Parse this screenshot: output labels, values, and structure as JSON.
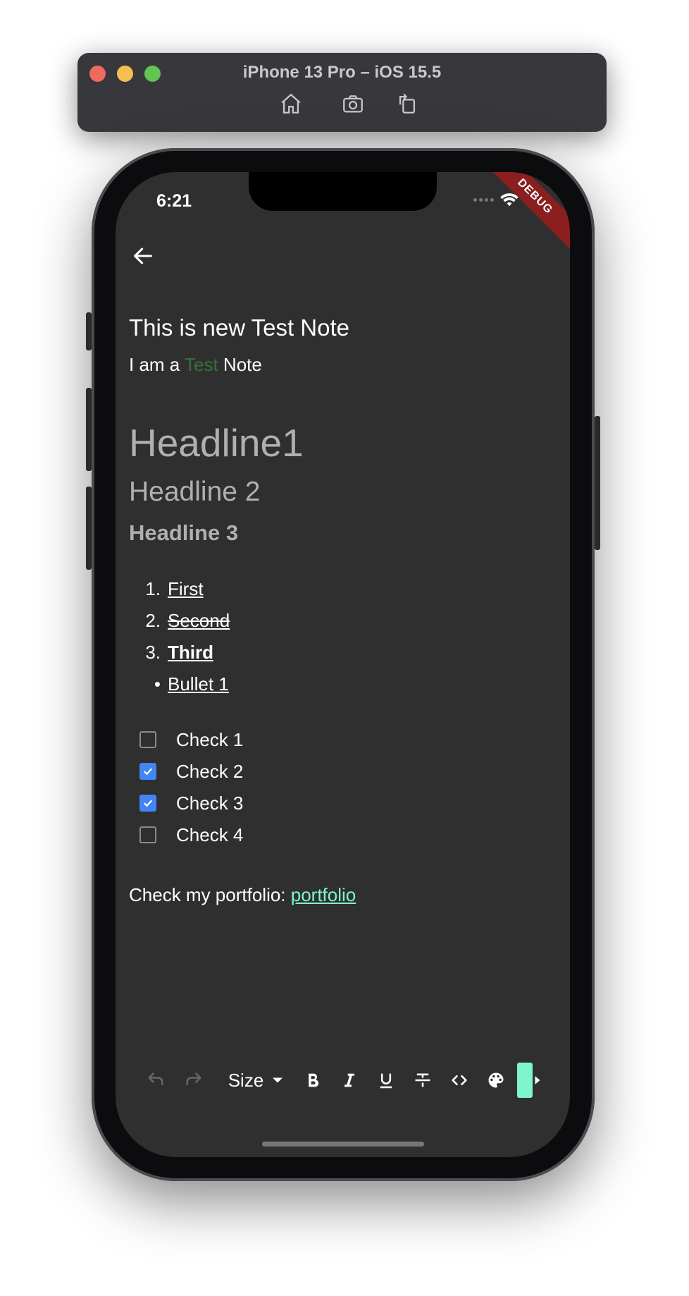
{
  "simulator": {
    "title": "iPhone 13 Pro – iOS 15.5",
    "buttons": [
      "home-icon",
      "screenshot-icon",
      "rotate-icon"
    ]
  },
  "status_bar": {
    "time": "6:21",
    "debug_label": "DEBUG"
  },
  "note": {
    "title": "This is new Test Note",
    "subtitle_prefix": "I am a ",
    "subtitle_highlight": "Test",
    "subtitle_suffix": " Note",
    "highlight_color": "#36703b",
    "headline1": "Headline1",
    "headline2": "Headline 2",
    "headline3": "Headline 3",
    "list": [
      {
        "marker": "1.",
        "text": "First",
        "style": "underline"
      },
      {
        "marker": "2.",
        "text": "Second",
        "style": "strikethrough"
      },
      {
        "marker": "3.",
        "text": "Third",
        "style": "bold"
      },
      {
        "marker": "•",
        "text": "Bullet 1",
        "style": "underline"
      }
    ],
    "checklist": [
      {
        "text": "Check 1",
        "checked": false
      },
      {
        "text": "Check 2",
        "checked": true
      },
      {
        "text": "Check 3",
        "checked": true
      },
      {
        "text": "Check 4",
        "checked": false
      }
    ],
    "portfolio_prefix": "Check my portfolio: ",
    "portfolio_link": "portfolio",
    "link_color": "#7ff5cf"
  },
  "toolbar": {
    "size_label": "Size",
    "icons": [
      "undo-icon",
      "redo-icon",
      "bold-icon",
      "italic-icon",
      "underline-icon",
      "strikethrough-icon",
      "code-icon",
      "palette-icon"
    ],
    "accent_color": "#7ff5cf"
  }
}
